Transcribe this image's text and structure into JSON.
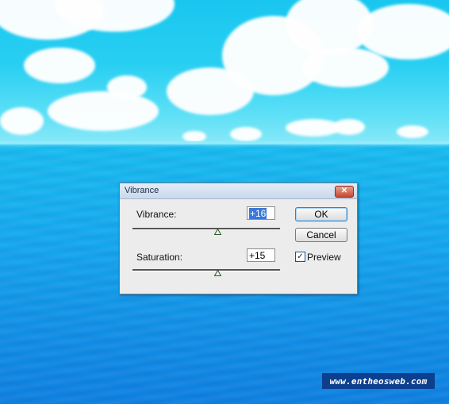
{
  "dialog": {
    "title": "Vibrance",
    "close_glyph": "✕",
    "vibrance": {
      "label": "Vibrance:",
      "value": "+16",
      "slider_fraction": 0.58
    },
    "saturation": {
      "label": "Saturation:",
      "value": "+15",
      "slider_fraction": 0.58
    },
    "ok_label": "OK",
    "cancel_label": "Cancel",
    "preview": {
      "label": "Preview",
      "checked": true,
      "check_glyph": "✓"
    }
  },
  "watermark": {
    "text": "www.entheosweb.com"
  },
  "icons": {
    "close": "close-icon",
    "check": "check-icon",
    "slider_thumb": "triangle-thumb-icon"
  },
  "colors": {
    "accent": "#3a78d8",
    "close_button": "#c9462f",
    "watermark_bg": "#0c3f8e"
  }
}
